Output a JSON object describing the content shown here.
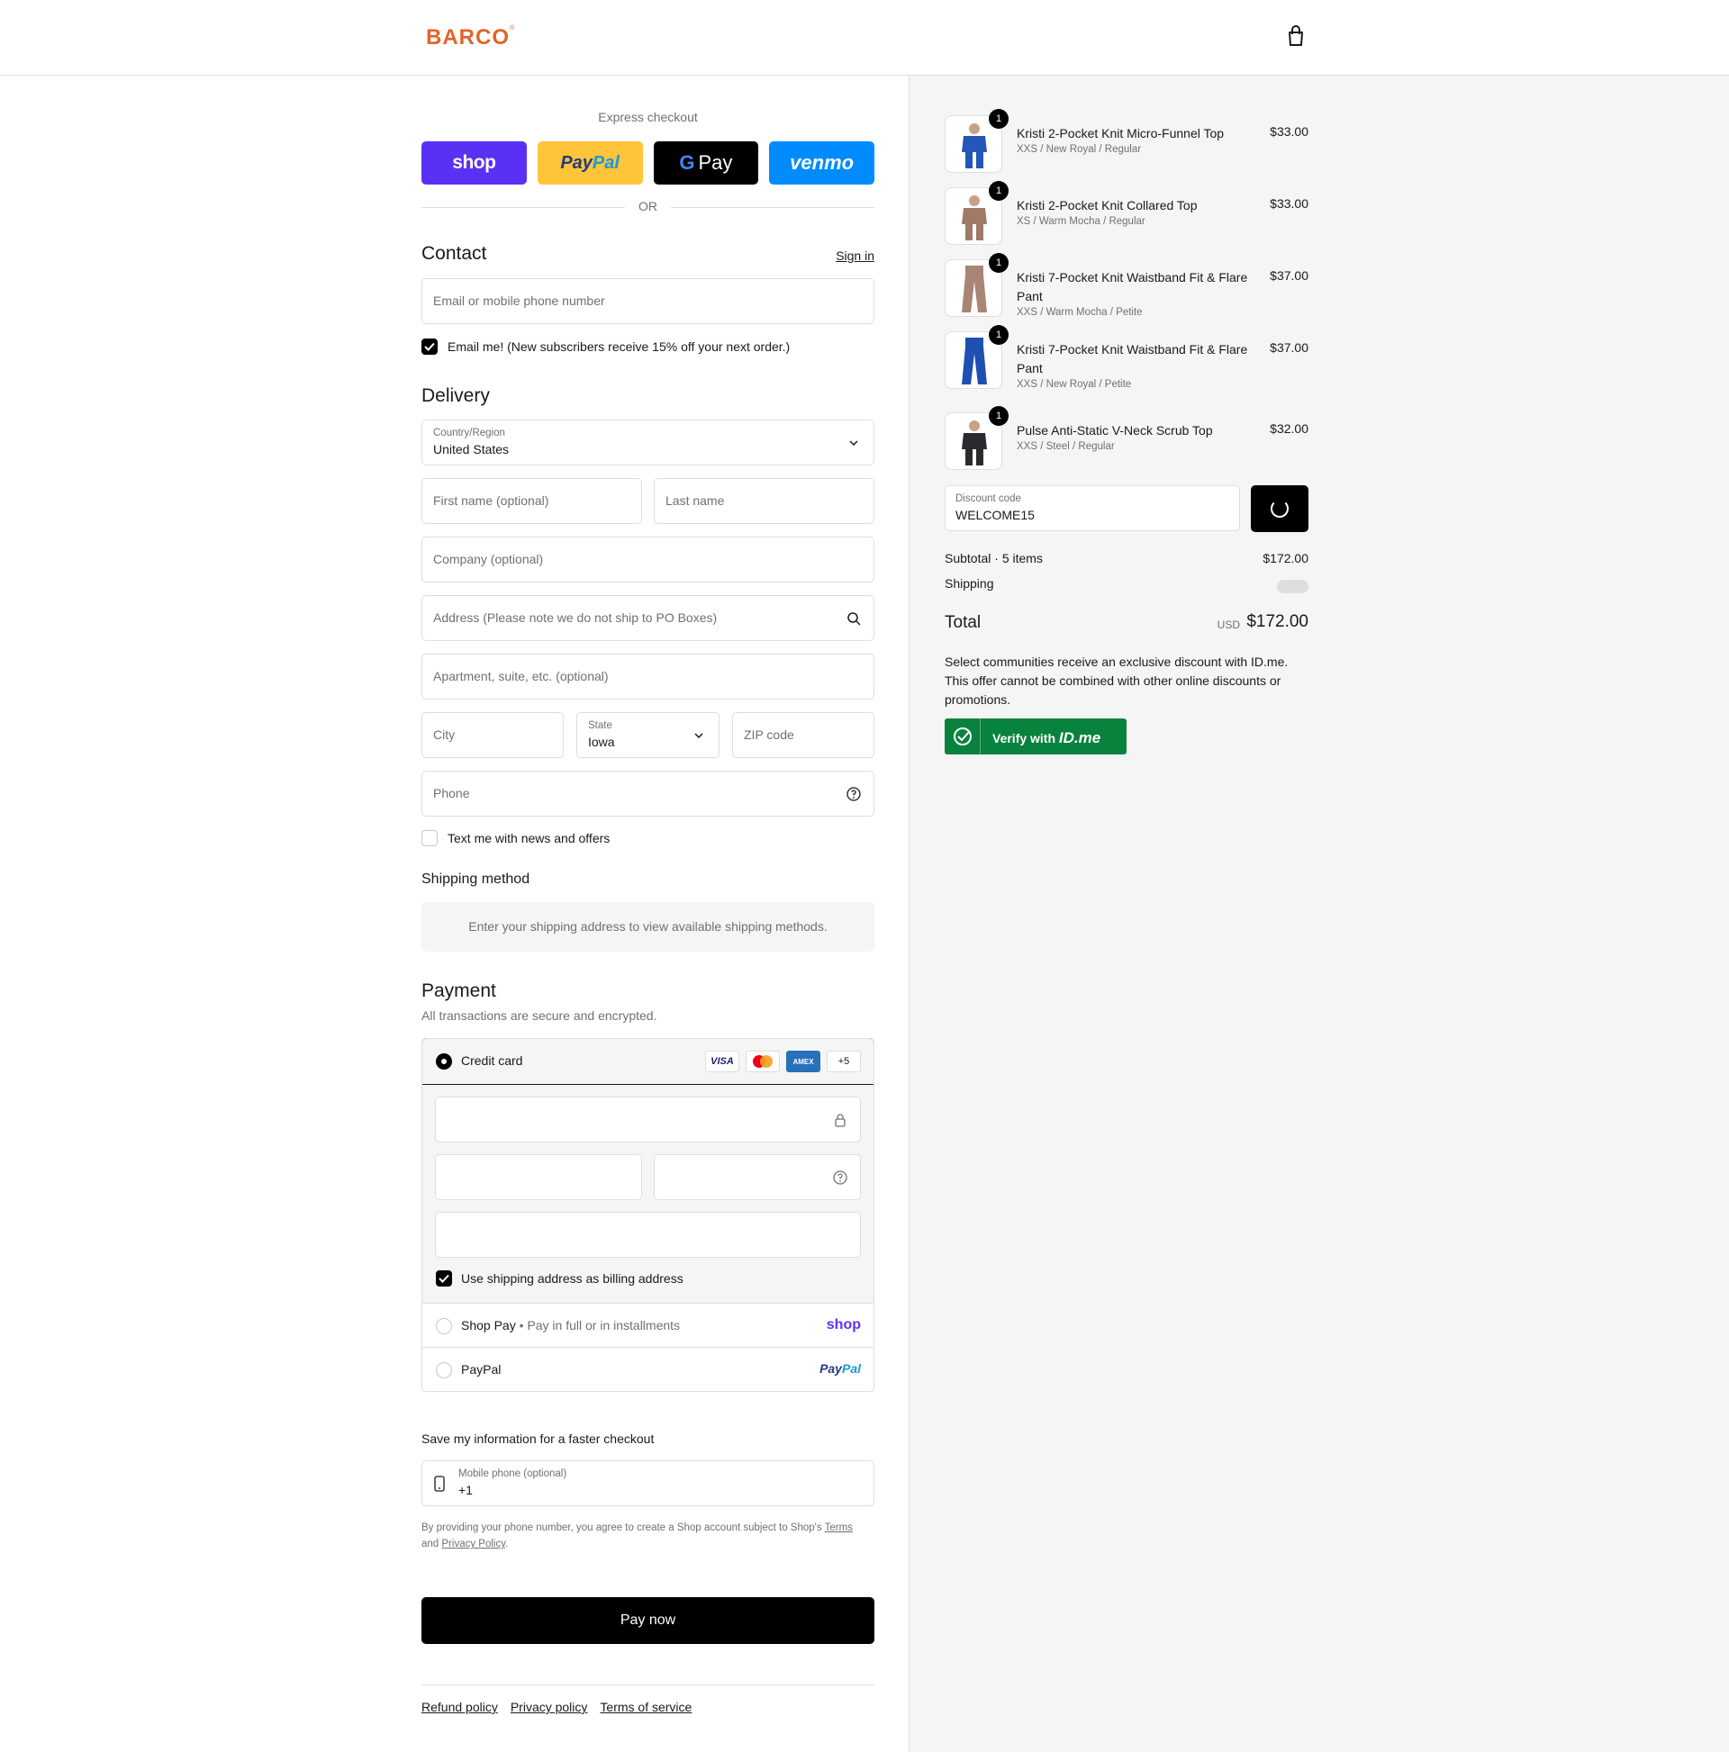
{
  "header": {
    "logo": "BARCO",
    "logo_mark": "®",
    "cart_icon": "shopping-bag-icon"
  },
  "express": {
    "title": "Express checkout",
    "buttons": [
      "shop",
      "PayPal",
      "Pay",
      "venmo"
    ],
    "or": "OR"
  },
  "contact": {
    "title": "Contact",
    "sign_in": "Sign in",
    "email_placeholder": "Email or mobile phone number",
    "email_me": "Email me! (New subscribers receive 15% off your next order.)",
    "email_me_checked": true
  },
  "delivery": {
    "title": "Delivery",
    "country_label": "Country/Region",
    "country_value": "United States",
    "first_name": "First name (optional)",
    "last_name": "Last name",
    "company": "Company (optional)",
    "address": "Address (Please note we do not ship to PO Boxes)",
    "apartment": "Apartment, suite, etc. (optional)",
    "city": "City",
    "state_label": "State",
    "state_value": "Iowa",
    "zip": "ZIP code",
    "phone": "Phone",
    "text_me": "Text me with news and offers",
    "text_me_checked": false
  },
  "shipping_method": {
    "title": "Shipping method",
    "message": "Enter your shipping address to view available shipping methods."
  },
  "payment": {
    "title": "Payment",
    "subtitle": "All transactions are secure and encrypted.",
    "credit_card_label": "Credit card",
    "card_brands": [
      "VISA",
      "AMEX",
      "+5"
    ],
    "billing_same": "Use shipping address as billing address",
    "billing_same_checked": true,
    "shop_pay": {
      "name": "Shop Pay",
      "sub": "Pay in full or in installments",
      "brand": "shop"
    },
    "paypal": {
      "name": "PayPal",
      "brand": "PayPal"
    }
  },
  "save_info": {
    "title": "Save my information for a faster checkout",
    "phone_label": "Mobile phone (optional)",
    "phone_value": "+1",
    "consent_text": "By providing your phone number, you agree to create a Shop account subject to Shop's",
    "terms": "Terms",
    "and": "and",
    "privacy": "Privacy Policy"
  },
  "pay_now": "Pay now",
  "footer": [
    "Refund policy",
    "Privacy policy",
    "Terms of service"
  ],
  "summary": {
    "items": [
      {
        "title": "Kristi 2-Pocket Knit Micro-Funnel Top",
        "variant": "XXS / New Royal / Regular",
        "price": "$33.00",
        "qty": "1",
        "color": "#2457b8"
      },
      {
        "title": "Kristi 2-Pocket Knit Collared Top",
        "variant": "XS / Warm Mocha / Regular",
        "price": "$33.00",
        "qty": "1",
        "color": "#a07a68"
      },
      {
        "title": "Kristi 7-Pocket Knit Waistband Fit & Flare Pant",
        "variant": "XXS / Warm Mocha / Petite",
        "price": "$37.00",
        "qty": "1",
        "color": "#a98575"
      },
      {
        "title": "Kristi 7-Pocket Knit Waistband Fit & Flare Pant",
        "variant": "XXS / New Royal / Petite",
        "price": "$37.00",
        "qty": "1",
        "color": "#1f4fb0"
      },
      {
        "title": "Pulse Anti-Static V-Neck Scrub Top",
        "variant": "XXS / Steel / Regular",
        "price": "$32.00",
        "qty": "1",
        "color": "#2a2a2e"
      }
    ],
    "discount_label": "Discount code",
    "discount_value": "WELCOME15",
    "subtotal_label": "Subtotal · 5 items",
    "subtotal_value": "$172.00",
    "shipping_label": "Shipping",
    "total_label": "Total",
    "currency": "USD",
    "total_value": "$172.00",
    "idme_text": "Select communities receive an exclusive discount with ID.me. This offer cannot be combined with other online discounts or promotions.",
    "idme_verify": "Verify with",
    "idme_brand": "ID.me"
  }
}
